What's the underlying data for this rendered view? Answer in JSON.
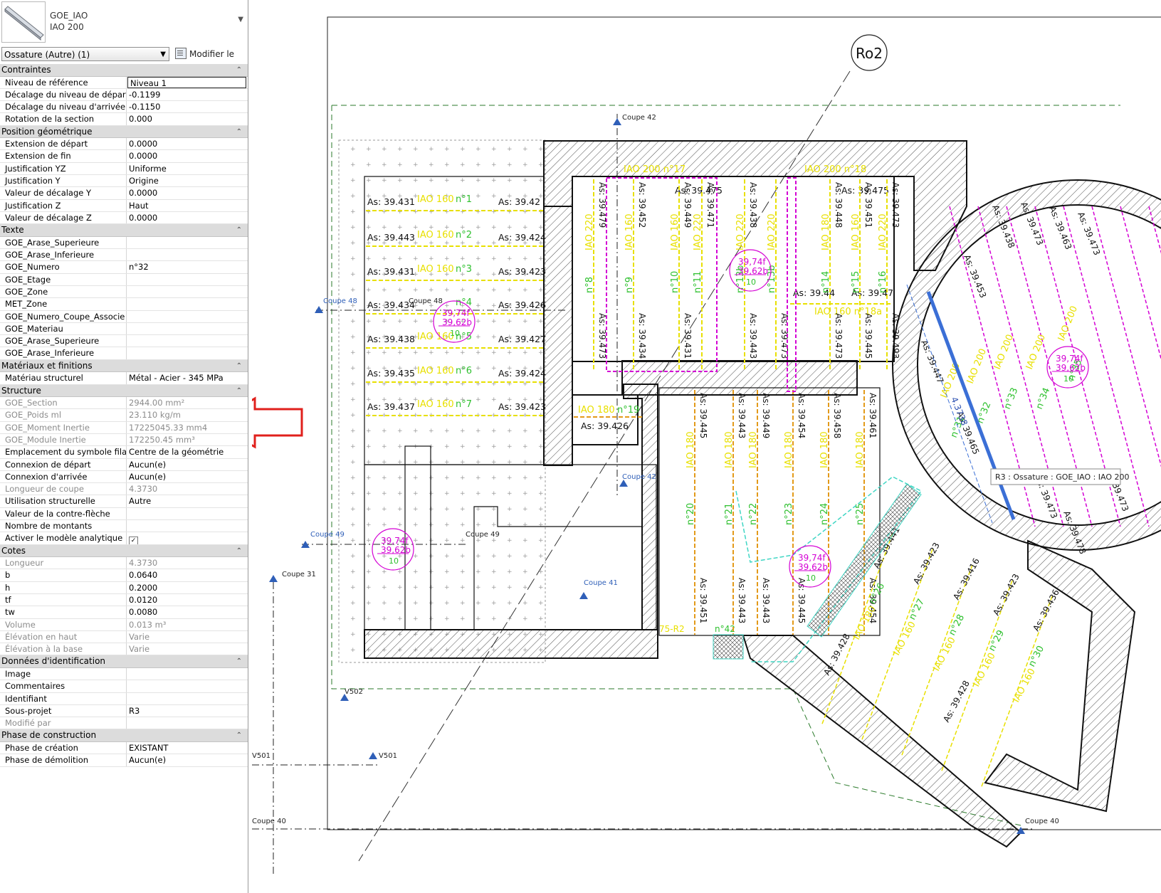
{
  "type_selector": {
    "family": "GOE_IAO",
    "type": "IAO 200",
    "dropdown_icon": "chevron-down-icon"
  },
  "instance": {
    "label": "Ossature (Autre) (1)",
    "edit_type_label": "Modifier le type"
  },
  "groups": [
    {
      "title": "Contraintes",
      "rows": [
        {
          "label": "Niveau de référence",
          "value": "Niveau 1",
          "editable": true
        },
        {
          "label": "Décalage du niveau de départ",
          "value": "-0.1199"
        },
        {
          "label": "Décalage du niveau d'arrivée",
          "value": "-0.1150"
        },
        {
          "label": "Rotation de la section",
          "value": "0.000"
        }
      ]
    },
    {
      "title": "Position géométrique",
      "rows": [
        {
          "label": "Extension de départ",
          "value": "0.0000"
        },
        {
          "label": "Extension de fin",
          "value": "0.0000"
        },
        {
          "label": "Justification YZ",
          "value": "Uniforme"
        },
        {
          "label": "Justification Y",
          "value": "Origine"
        },
        {
          "label": "Valeur de décalage Y",
          "value": "0.0000"
        },
        {
          "label": "Justification Z",
          "value": "Haut"
        },
        {
          "label": "Valeur de décalage Z",
          "value": "0.0000"
        }
      ]
    },
    {
      "title": "Texte",
      "rows": [
        {
          "label": "GOE_Arase_Superieure",
          "value": ""
        },
        {
          "label": "GOE_Arase_Inferieure",
          "value": ""
        },
        {
          "label": "GOE_Numero",
          "value": "n°32"
        },
        {
          "label": "GOE_Etage",
          "value": ""
        },
        {
          "label": "GOE_Zone",
          "value": ""
        },
        {
          "label": "MET_Zone",
          "value": ""
        },
        {
          "label": "GOE_Numero_Coupe_Associe",
          "value": ""
        },
        {
          "label": "GOE_Materiau",
          "value": ""
        },
        {
          "label": "GOE_Arase_Superieure",
          "value": ""
        },
        {
          "label": "GOE_Arase_Inferieure",
          "value": ""
        }
      ]
    },
    {
      "title": "Matériaux et finitions",
      "rows": [
        {
          "label": "Matériau structurel",
          "value": "Métal - Acier - 345 MPa"
        }
      ]
    },
    {
      "title": "Structure",
      "rows": [
        {
          "label": "GOE_Section",
          "value": "2944.00 mm²",
          "readonly": true
        },
        {
          "label": "GOE_Poids ml",
          "value": "23.110 kg/m",
          "readonly": true
        },
        {
          "label": "GOE_Moment Inertie",
          "value": "17225045.33 mm4",
          "readonly": true
        },
        {
          "label": "GOE_Module Inertie",
          "value": "172250.45 mm³",
          "readonly": true
        },
        {
          "label": "Emplacement du symbole filaire",
          "value": "Centre de la géométrie"
        },
        {
          "label": "Connexion de départ",
          "value": "Aucun(e)"
        },
        {
          "label": "Connexion d'arrivée",
          "value": "Aucun(e)"
        },
        {
          "label": "Longueur de coupe",
          "value": "4.3730",
          "readonly": true
        },
        {
          "label": "Utilisation structurelle",
          "value": "Autre"
        },
        {
          "label": "Valeur de la contre-flèche",
          "value": ""
        },
        {
          "label": "Nombre de montants",
          "value": ""
        },
        {
          "label": "Activer le modèle analytique",
          "value": "",
          "checkbox": true
        }
      ]
    },
    {
      "title": "Cotes",
      "rows": [
        {
          "label": "Longueur",
          "value": "4.3730",
          "readonly": true
        },
        {
          "label": "b",
          "value": "0.0640"
        },
        {
          "label": "h",
          "value": "0.2000"
        },
        {
          "label": "tf",
          "value": "0.0120"
        },
        {
          "label": "tw",
          "value": "0.0080"
        },
        {
          "label": "Volume",
          "value": "0.013 m³",
          "readonly": true
        },
        {
          "label": "Élévation en haut",
          "value": "Varie",
          "readonly": true
        },
        {
          "label": "Élévation à la base",
          "value": "Varie",
          "readonly": true
        }
      ]
    },
    {
      "title": "Données d'identification",
      "rows": [
        {
          "label": "Image",
          "value": ""
        },
        {
          "label": "Commentaires",
          "value": ""
        },
        {
          "label": "Identifiant",
          "value": ""
        },
        {
          "label": "Sous-projet",
          "value": "R3"
        },
        {
          "label": "Modifié par",
          "value": "",
          "readonly": true
        }
      ]
    },
    {
      "title": "Phase de construction",
      "rows": [
        {
          "label": "Phase de création",
          "value": "EXISTANT"
        },
        {
          "label": "Phase de démolition",
          "value": "Aucun(e)"
        }
      ]
    }
  ],
  "drawing": {
    "grid_bubble": "Ro2",
    "tooltip": "R3 : Ossature : GOE_IAO : IAO 200",
    "section_labels": [
      "Coupe 42",
      "Coupe 48",
      "Coupe 48",
      "Coupe 49",
      "Coupe 49",
      "Coupe 31",
      "Coupe 41",
      "Coupe 42",
      "V502",
      "V501",
      "V501",
      "Coupe 40",
      "Coupe 40"
    ],
    "tags_left": [
      {
        "as_left": "As: 39.431",
        "beam": "IAO 160",
        "num": "n°1",
        "as_right": "As: 39.42"
      },
      {
        "as_left": "As: 39.443",
        "beam": "IAO 160",
        "num": "n°2",
        "as_right": "As: 39.424"
      },
      {
        "as_left": "As: 39.431",
        "beam": "IAO 160",
        "num": "n°3",
        "as_right": "As: 39.423"
      },
      {
        "as_left": "As: 39.434",
        "beam": "",
        "num": "n°4",
        "as_right": "As: 39.426"
      },
      {
        "as_left": "As: 39.438",
        "beam": "IAO 160",
        "num": "n°5",
        "as_right": "As: 39.427"
      },
      {
        "as_left": "As: 39.435",
        "beam": "IAO 160",
        "num": "n°6",
        "as_right": "As: 39.424"
      },
      {
        "as_left": "As: 39.437",
        "beam": "IAO 160",
        "num": "n°7",
        "as_right": "As: 39.423"
      }
    ],
    "level_circles": [
      {
        "top": "39,74f",
        "mid": "39,62b",
        "bot": "10"
      },
      {
        "top": "39,74f",
        "mid": "39,62b",
        "bot": "10"
      },
      {
        "top": "39,74f",
        "mid": "39,62b",
        "bot": "10"
      },
      {
        "top": "39,74f",
        "mid": "39,62b",
        "bot": "10"
      },
      {
        "top": "39,74f",
        "mid": "39,62b",
        "bot": "10"
      }
    ],
    "misc_labels": {
      "top_beam_17": "IAO 200 n°17",
      "top_beam_18": "IAO 200 n°18",
      "beam_19": "IAO 180",
      "num_19": "n°19",
      "as_19": "As: 39.426",
      "as_top_1": "As: 39.475",
      "as_top_2": "As: 39.475",
      "as_44": "As: 39.44",
      "as_47": "As: 39.47",
      "beam_18a": "IAO 160 n°18a"
    },
    "vertical_tags": [
      {
        "as_top": "As: 39.479",
        "beam": "IAO 220",
        "num": "n°8",
        "as_bot": "As: 39.473"
      },
      {
        "as_top": "As: 39.452",
        "beam": "IAO 160",
        "num": "n°9",
        "as_bot": "As: 39.434"
      },
      {
        "as_top": "As: 39.449",
        "beam": "IAO 160",
        "num": "n°10",
        "as_bot": "As: 39.431"
      },
      {
        "as_top": "As: 39.471",
        "beam": "IAO 220",
        "num": "n°11",
        "as_bot": ""
      },
      {
        "as_top": "As: 39.438",
        "beam": "IAO 220",
        "num": "n°13b",
        "as_bot": "As: 39.443"
      },
      {
        "as_top": "",
        "beam": "IAO 220",
        "num": "n°13b",
        "as_bot": "As: 39.473"
      },
      {
        "as_top": "As: 39.448",
        "beam": "IAO 180",
        "num": "n°14",
        "as_bot": "As: 39.473"
      },
      {
        "as_top": "As: 39.451",
        "beam": "IAO 160",
        "num": "n°15",
        "as_bot": "As: 39.445"
      },
      {
        "as_top": "As: 39.473",
        "beam": "IAO 220",
        "num": "n°16",
        "as_bot": "As: 39.493"
      },
      {
        "as_top": "As: 39.445",
        "beam": "IAO 180",
        "num": "n°20",
        "as_bot": "As: 39.451"
      },
      {
        "as_top": "As: 39.443",
        "beam": "IAO 180",
        "num": "n°21",
        "as_bot": "As: 39.443"
      },
      {
        "as_top": "As: 39.449",
        "beam": "IAO 180",
        "num": "n°22",
        "as_bot": "As: 39.443"
      },
      {
        "as_top": "As: 39.454",
        "beam": "IAO 180",
        "num": "n°23",
        "as_bot": "As: 39.445"
      },
      {
        "as_top": "As: 39.458",
        "beam": "IAO 180",
        "num": "n°24",
        "as_bot": ""
      },
      {
        "as_top": "As: 39.461",
        "beam": "IAO 180",
        "num": "n°25",
        "as_bot": "As: 39.454"
      }
    ],
    "diag_tags": [
      {
        "as_top": "As: 39.441",
        "beam": "IAO 180",
        "num": "n°26",
        "as_bot": "As: 39.428"
      },
      {
        "as_top": "As: 39.423",
        "beam": "IAO 160",
        "num": "n°27",
        "as_bot": ""
      },
      {
        "as_top": "As: 39.416",
        "beam": "IAO 160",
        "num": "n°28",
        "as_bot": ""
      },
      {
        "as_top": "As: 39.423",
        "beam": "IAO 160",
        "num": "n°29",
        "as_bot": "As: 39.428"
      },
      {
        "as_top": "As: 39.436",
        "beam": "IAO 160",
        "num": "n°30",
        "as_bot": ""
      }
    ],
    "circle_tags": [
      {
        "as": "As: 39.438"
      },
      {
        "as": "As: 39.473"
      },
      {
        "as": "As: 39.463"
      },
      {
        "as": "As: 39.473"
      },
      {
        "as": "As: 39.453"
      },
      {
        "as": "As: 39.447"
      },
      {
        "as": "As: 39.465"
      },
      {
        "as": "As: 39.473"
      },
      {
        "as": "As: 39.478"
      },
      {
        "as": "As: 39.473"
      }
    ],
    "circle_beams": [
      {
        "beam": "IAO 200",
        "num": "n°32"
      },
      {
        "beam": "IAO 200",
        "num": "n°33"
      },
      {
        "beam": "IAO 200",
        "num": "n°34"
      },
      {
        "beam": "IAO 200",
        "num": "n°35"
      },
      {
        "beam": "IAO 200",
        "num": "n°31"
      }
    ],
    "dim_label": "4.3738",
    "left_bottom_label": "75-R2",
    "small_label": "n°42"
  },
  "colors": {
    "yellow_tag": "#e8e000",
    "green_num": "#2ec02e",
    "magenta": "#d400d4",
    "orange": "#e39a1a",
    "cyan": "#3fd6c4",
    "blue_sel": "#3b6fd6",
    "red_arrow": "#e0201c"
  }
}
